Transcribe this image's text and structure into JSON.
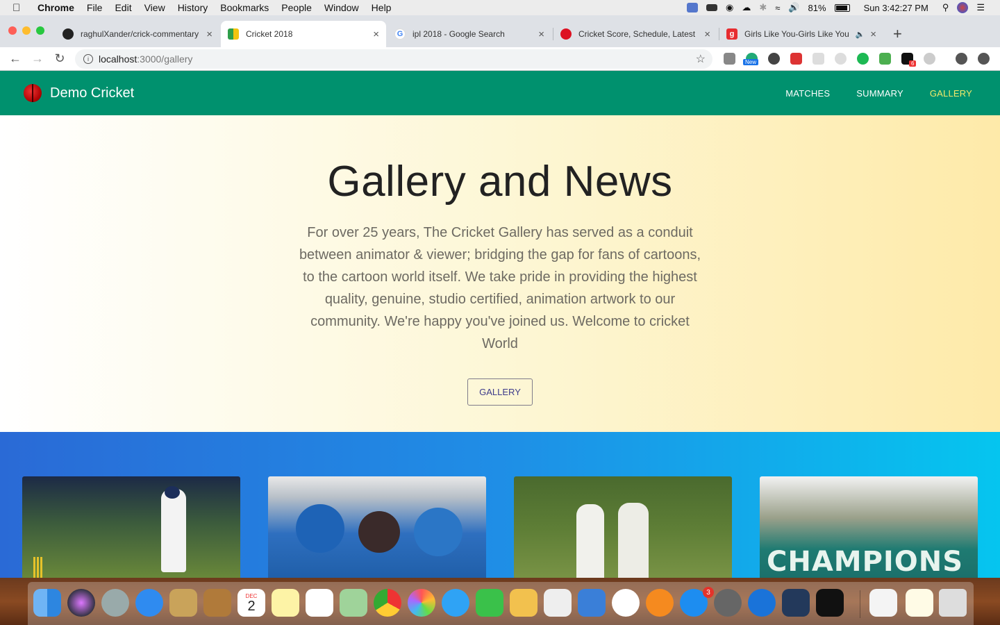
{
  "menubar": {
    "app": "Chrome",
    "items": [
      "File",
      "Edit",
      "View",
      "History",
      "Bookmarks",
      "People",
      "Window",
      "Help"
    ],
    "battery": "81%",
    "clock": "Sun 3:42:27 PM"
  },
  "tabs": [
    {
      "label": "raghulXander/crick-commentary",
      "favicon": "github-icon"
    },
    {
      "label": "Cricket 2018",
      "favicon": "cricket-app-icon"
    },
    {
      "label": "ipl 2018 - Google Search",
      "favicon": "google-icon"
    },
    {
      "label": "Cricket Score, Schedule, Latest",
      "favicon": "cricbuzz-icon"
    },
    {
      "label": "Girls Like You-Girls Like You",
      "favicon": "gaana-icon"
    }
  ],
  "address": {
    "host": "localhost",
    "path": ":3000/gallery"
  },
  "extensions": {
    "new_badge": "New",
    "count_badge": "6"
  },
  "site": {
    "brand": "Demo Cricket",
    "nav": [
      "MATCHES",
      "SUMMARY",
      "GALLERY"
    ],
    "active_nav": "GALLERY",
    "accent": "#00916e",
    "active_color": "#f2e96a"
  },
  "hero": {
    "title": "Gallery and News",
    "body": "For over 25 years, The Cricket Gallery has served as a conduit between animator & viewer; bridging the gap for fans of cartoons, to the cartoon world itself. We take pride in providing the highest quality, genuine, studio certified, animation artwork to our community. We're happy you've joined us. Welcome to cricket World",
    "button": "GALLERY"
  },
  "gallery": {
    "card4_text": "CHAMPIONS"
  },
  "dock": {
    "calendar_month": "DEC",
    "calendar_day": "2",
    "appstore_badge": "3"
  }
}
